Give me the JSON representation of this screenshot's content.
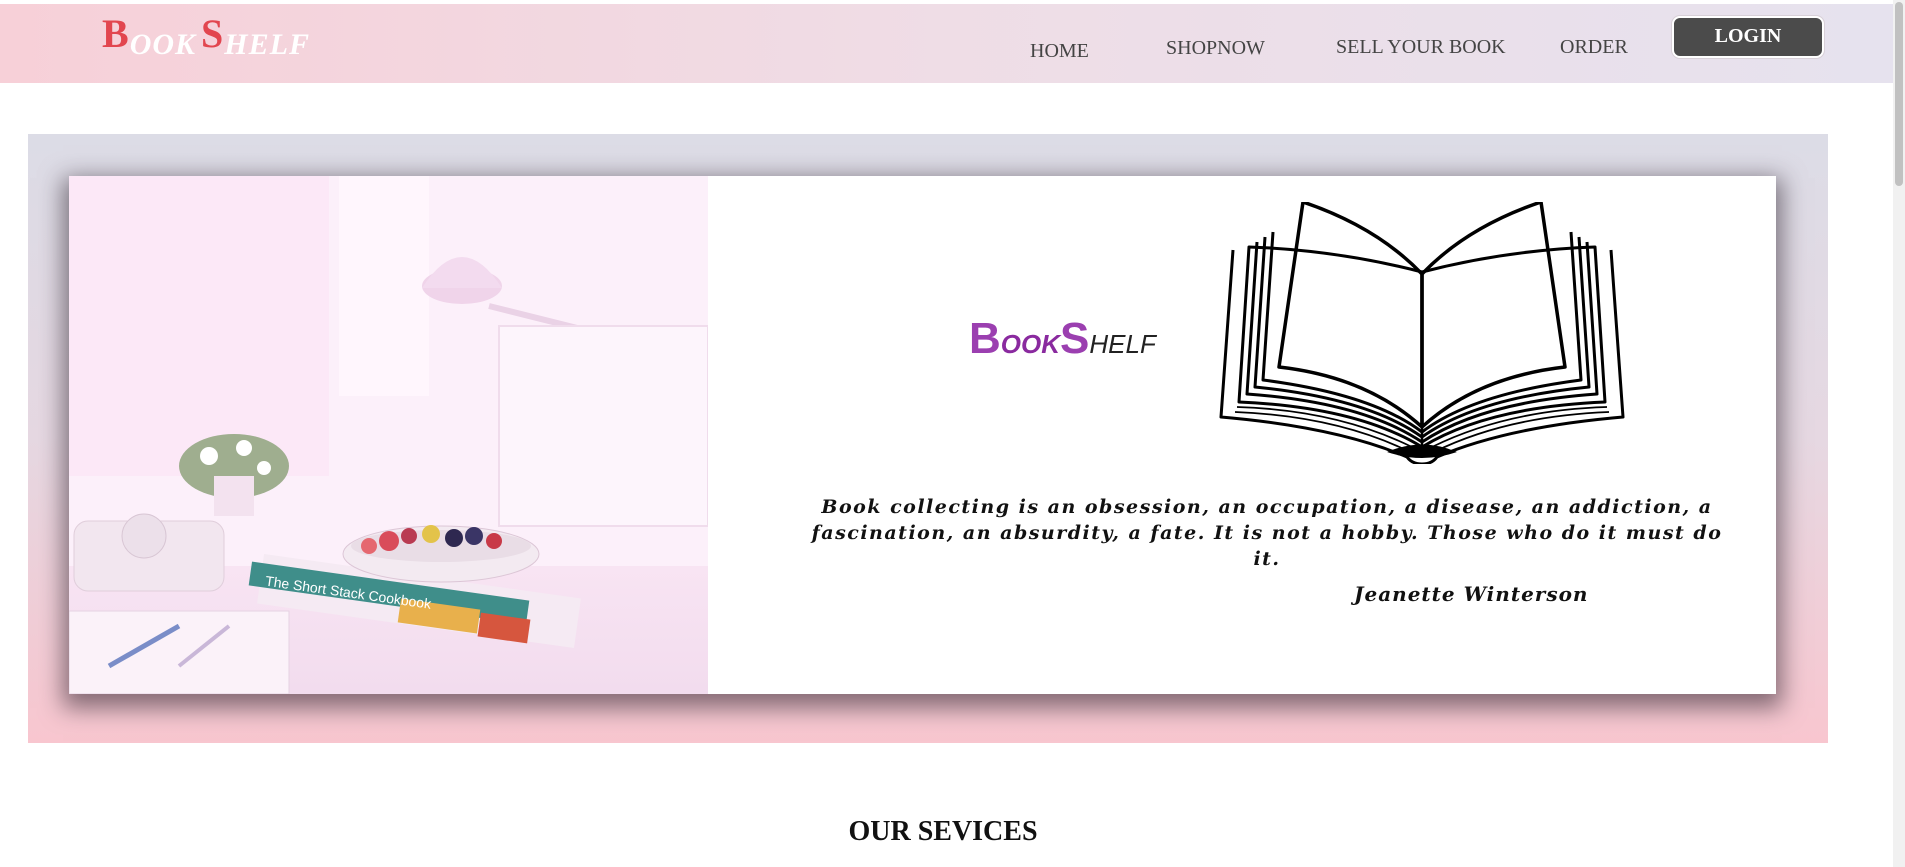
{
  "header": {
    "logo": {
      "cap1": "B",
      "rest1": "OOK",
      "cap2": "S",
      "rest2": "HELF"
    },
    "nav": {
      "home": "HOME",
      "shopnow": "SHOPNOW",
      "sell": "SELL YOUR BOOK",
      "order": "ORDER"
    },
    "login_label": "LOGIN"
  },
  "hero": {
    "brand": {
      "cap1": "B",
      "rest1": "OOK",
      "cap2": "S",
      "rest2": "HELF"
    },
    "photo_book_title": "The Short Stack Cookbook",
    "quote": "Book collecting is an obsession, an occupation, a disease, an addiction, a fascination, an absurdity, a fate. It is not a hobby. Those who do it must do it.",
    "quote_author": "Jeanette Winterson"
  },
  "sections": {
    "services_title": "OUR SEVICES"
  },
  "colors": {
    "logo_accent": "#e2464f",
    "brand_purple": "#9b3fb0",
    "login_bg": "#4b4b4b",
    "nav_gradient_start": "#f7d0d8",
    "nav_gradient_end": "#e6e2ee"
  }
}
